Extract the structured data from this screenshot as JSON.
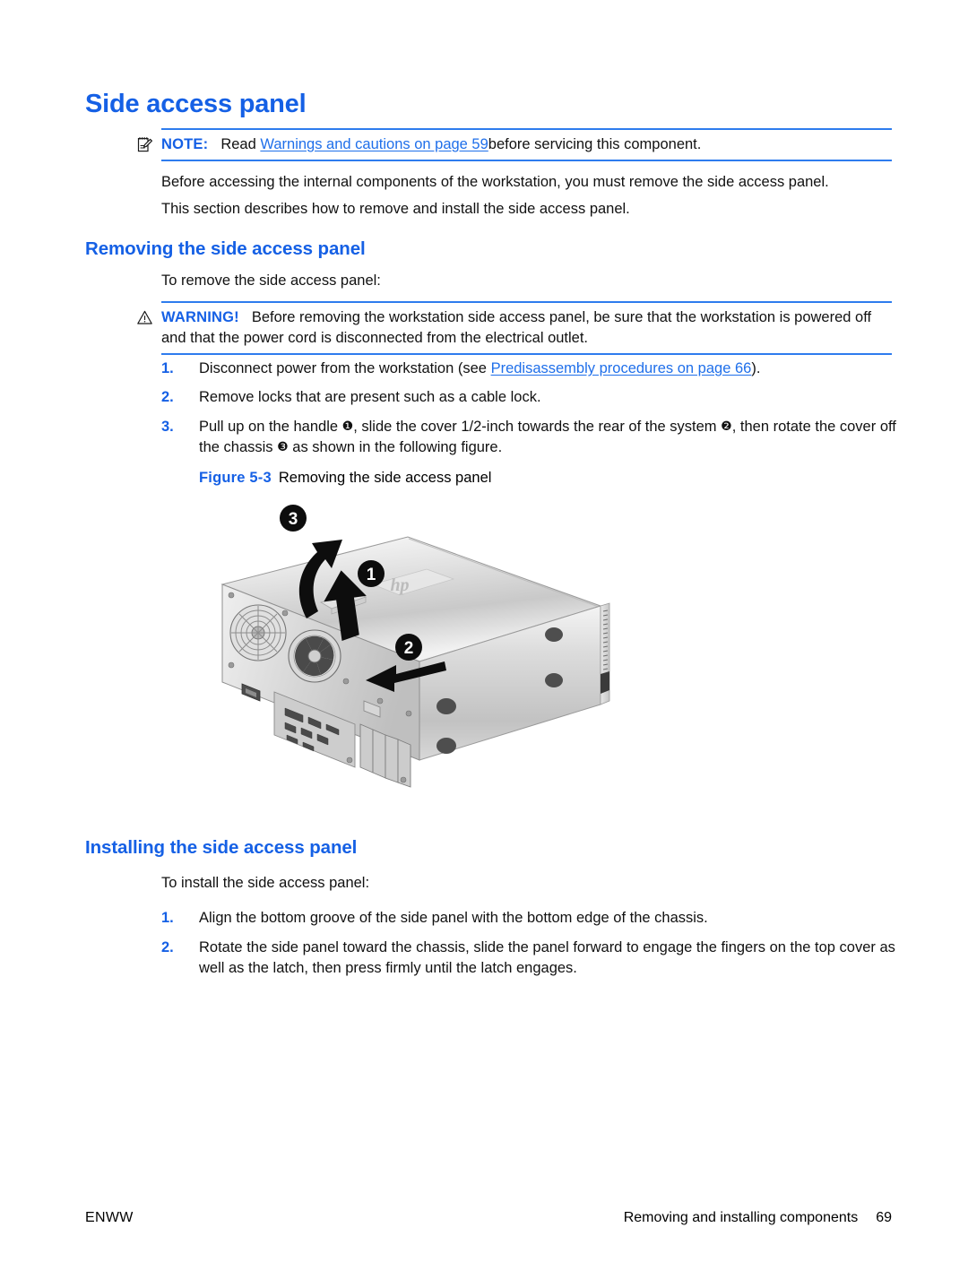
{
  "page": {
    "title": "Side access panel"
  },
  "note": {
    "icon": "note-pad-pencil-icon",
    "label": "NOTE:",
    "text_before": "Read",
    "link_text": "Warnings and cautions on page 59",
    "text_after": "before servicing this component."
  },
  "intro": {
    "paragraph_1": "Before accessing the internal components of the workstation, you must remove the side access panel.",
    "paragraph_2": "This section describes how to remove and install the side access panel."
  },
  "removing": {
    "heading": "Removing the side access panel",
    "lead": "To remove the side access panel:",
    "warning": {
      "icon": "warning-triangle-icon",
      "label": "WARNING!",
      "text": "Before removing the workstation side access panel, be sure that the workstation is powered off and that the power cord is disconnected from the electrical outlet."
    },
    "steps": [
      {
        "number": "1.",
        "text_before": "Disconnect power from the workstation (see",
        "link_text": "Predisassembly procedures on page 66",
        "text_after": ")."
      },
      {
        "number": "2.",
        "text": "Remove locks that are present such as a cable lock."
      },
      {
        "number": "3.",
        "segment_1": "Pull up on the handle",
        "callout_1": "❶",
        "segment_2": ", slide the cover 1/2-inch towards the rear of the system",
        "callout_2": "❷",
        "segment_3": ", then rotate the cover off the chassis",
        "callout_3": "❸",
        "segment_4": "as shown in the following figure."
      }
    ]
  },
  "figure": {
    "label": "Figure 5-3",
    "caption": "Removing the side access panel",
    "alt": "HP workstation lying on its side showing rear panel with fans, I/O ports and expansion slots; arrows indicate lifting the handle, sliding the cover rearward and rotating it off the chassis.",
    "callouts": [
      {
        "id": "1",
        "meaning": "pull up on the handle"
      },
      {
        "id": "2",
        "meaning": "slide cover toward rear"
      },
      {
        "id": "3",
        "meaning": "rotate cover off chassis"
      }
    ]
  },
  "installing": {
    "heading": "Installing the side access panel",
    "lead": "To install the side access panel:",
    "steps": [
      {
        "number": "1.",
        "text": "Align the bottom groove of the side panel with the bottom edge of the chassis."
      },
      {
        "number": "2.",
        "text": "Rotate the side panel toward the chassis, slide the panel forward to engage the fingers on the top cover as well as the latch, then press firmly until the latch engages."
      }
    ]
  },
  "footer": {
    "left": "ENWW",
    "right": "Removing and installing components",
    "page_number": "69"
  },
  "colors": {
    "heading_blue": "#1560E5",
    "rule_blue": "#2E7CEE",
    "link_blue": "#1F6FEA",
    "body_black": "#111111"
  }
}
